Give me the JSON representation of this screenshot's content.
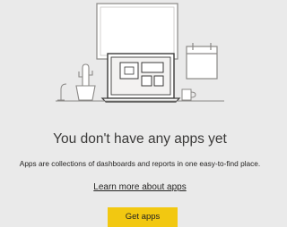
{
  "empty_state": {
    "title": "You don't have any apps yet",
    "description": "Apps are collections of dashboards and reports in one easy-to-find place.",
    "learn_more_link": "Learn more about apps",
    "cta_button": "Get apps"
  },
  "colors": {
    "background": "#eaeaea",
    "button": "#f2c811",
    "illustration_stroke": "#8a8886",
    "illustration_fill": "#ffffff"
  },
  "illustration_icons": [
    "picture-frame-icon",
    "calendar-icon",
    "cactus-plant-icon",
    "desk-lamp-icon",
    "laptop-dashboard-icon",
    "coffee-mug-icon"
  ]
}
